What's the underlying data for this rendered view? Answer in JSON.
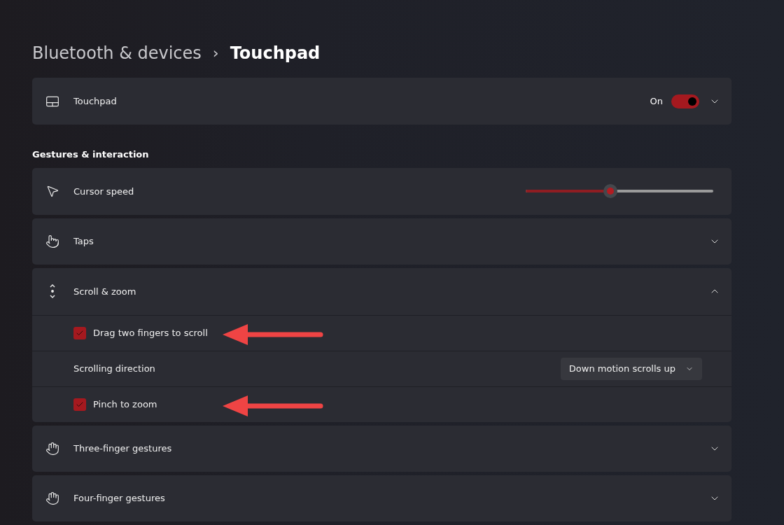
{
  "breadcrumb": {
    "parent": "Bluetooth & devices",
    "separator": "›",
    "current": "Touchpad"
  },
  "touchpad": {
    "label": "Touchpad",
    "state_label": "On",
    "on": true,
    "expanded": false
  },
  "section_title": "Gestures & interaction",
  "items": [
    {
      "kind": "slider",
      "label": "Cursor speed",
      "level": 0.45
    },
    {
      "kind": "expander",
      "label": "Taps",
      "expanded": false
    },
    {
      "kind": "expander",
      "label": "Scroll & zoom",
      "expanded": true,
      "children": [
        {
          "kind": "checkbox",
          "label": "Drag two fingers to scroll",
          "checked": true,
          "annotated": true
        },
        {
          "kind": "dropdown",
          "label": "Scrolling direction",
          "value": "Down motion scrolls up"
        },
        {
          "kind": "checkbox",
          "label": "Pinch to zoom",
          "checked": true,
          "annotated": true
        }
      ]
    },
    {
      "kind": "expander",
      "label": "Three-finger gestures",
      "expanded": false
    },
    {
      "kind": "expander",
      "label": "Four-finger gestures",
      "expanded": false
    }
  ]
}
